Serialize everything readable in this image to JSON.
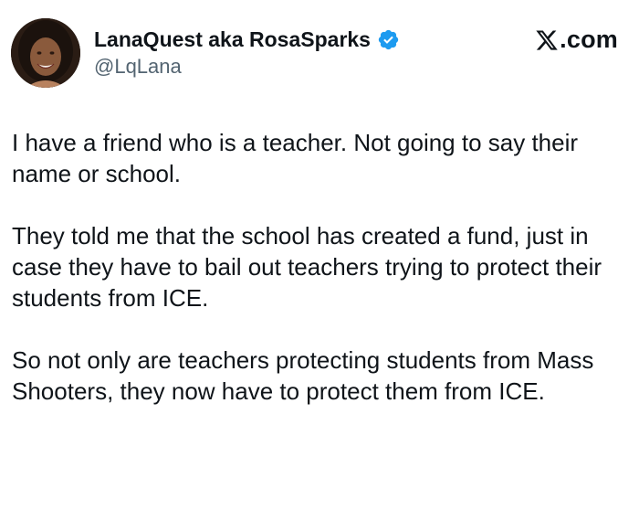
{
  "author": {
    "display_name": "LanaQuest aka RosaSparks",
    "handle": "@LqLana",
    "verified": true
  },
  "brand": {
    "label": ".com",
    "logo_icon": "x-logo-icon"
  },
  "tweet": {
    "paragraphs": [
      "I have a friend who is a teacher. Not going to say their name or school.",
      "They told me that the school has created a fund, just in case they have to bail out teachers trying to protect their students from ICE.",
      "So not only are teachers protecting students from Mass Shooters, they now have to protect them from ICE."
    ]
  },
  "colors": {
    "text": "#0f1419",
    "secondary": "#536471",
    "verified_blue": "#1d9bf0",
    "background": "#ffffff"
  }
}
